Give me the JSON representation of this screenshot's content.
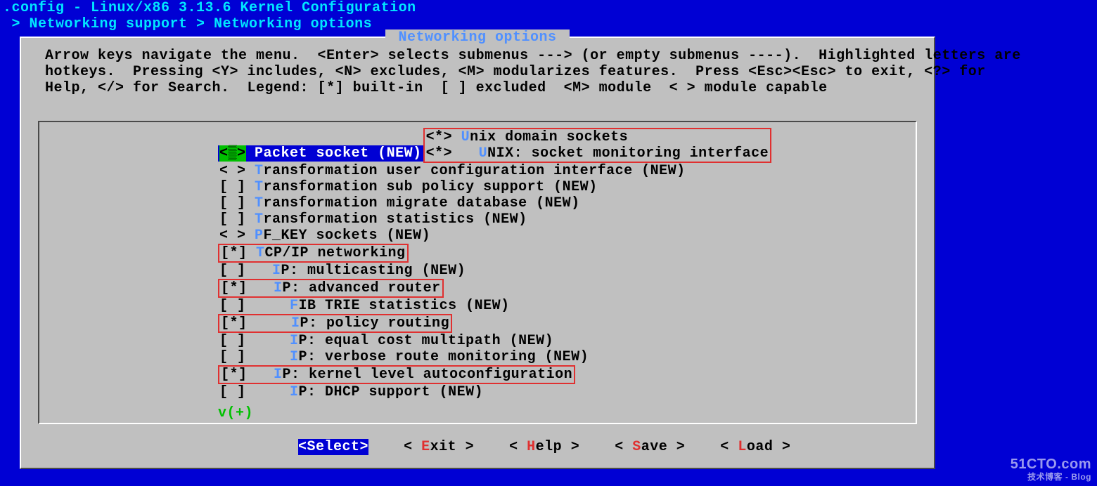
{
  "header": {
    "title": ".config - Linux/x86 3.13.6 Kernel Configuration",
    "breadcrumb": " > Networking support > Networking options "
  },
  "box": {
    "title": " Networking options ",
    "help_l1": "Arrow keys navigate the menu.  <Enter> selects submenus ---> (or empty submenus ----).  Highlighted letters are",
    "help_l2": "hotkeys.  Pressing <Y> includes, <N> excludes, <M> modularizes features.  Press <Esc><Esc> to exit, <?> for",
    "help_l3": "Help, </> for Search.  Legend: [*] built-in  [ ] excluded  <M> module  < > module capable"
  },
  "items": [
    {
      "mark": "<▒>",
      "indent": "",
      "hotkey": "P",
      "label": "acket socket (NEW)",
      "selected": true
    },
    {
      "mark": "<*>",
      "indent": "",
      "hotkey": "U",
      "label": "nix domain sockets",
      "highlight": true
    },
    {
      "mark": "<*>",
      "indent": "  ",
      "hotkey": "U",
      "label": "NIX: socket monitoring interface",
      "highlight": true,
      "same_red": true
    },
    {
      "mark": "< >",
      "indent": "",
      "hotkey": "T",
      "label": "ransformation user configuration interface (NEW)"
    },
    {
      "mark": "[ ]",
      "indent": "",
      "hotkey": "T",
      "label": "ransformation sub policy support (NEW)"
    },
    {
      "mark": "[ ]",
      "indent": "",
      "hotkey": "T",
      "label": "ransformation migrate database (NEW)"
    },
    {
      "mark": "[ ]",
      "indent": "",
      "hotkey": "T",
      "label": "ransformation statistics (NEW)"
    },
    {
      "mark": "< >",
      "indent": "",
      "hotkey": "P",
      "label": "F_KEY sockets (NEW)"
    },
    {
      "mark": "[*]",
      "indent": "",
      "hotkey": "T",
      "label": "CP/IP networking",
      "highlight": true
    },
    {
      "mark": "[ ]",
      "indent": "  ",
      "hotkey": "I",
      "label": "P: multicasting (NEW)"
    },
    {
      "mark": "[*]",
      "indent": "  ",
      "hotkey": "I",
      "label": "P: advanced router",
      "highlight": true
    },
    {
      "mark": "[ ]",
      "indent": "    ",
      "hotkey": "F",
      "label": "IB TRIE statistics (NEW)"
    },
    {
      "mark": "[*]",
      "indent": "    ",
      "hotkey": "I",
      "label": "P: policy routing",
      "highlight": true
    },
    {
      "mark": "[ ]",
      "indent": "    ",
      "hotkey": "I",
      "label": "P: equal cost multipath (NEW)"
    },
    {
      "mark": "[ ]",
      "indent": "    ",
      "hotkey": "I",
      "label": "P: verbose route monitoring (NEW)"
    },
    {
      "mark": "[*]",
      "indent": "  ",
      "hotkey": "I",
      "label": "P: kernel level autoconfiguration",
      "highlight": true
    },
    {
      "mark": "[ ]",
      "indent": "    ",
      "hotkey": "I",
      "label": "P: DHCP support (NEW)"
    }
  ],
  "scroll_indicator": "v(+)",
  "buttons": {
    "select": "Select",
    "exit": "Exit",
    "help": "Help",
    "save": "Save",
    "load": "Load"
  },
  "watermark": {
    "main": "51CTO.com",
    "sub": "技术博客 - Blog"
  }
}
